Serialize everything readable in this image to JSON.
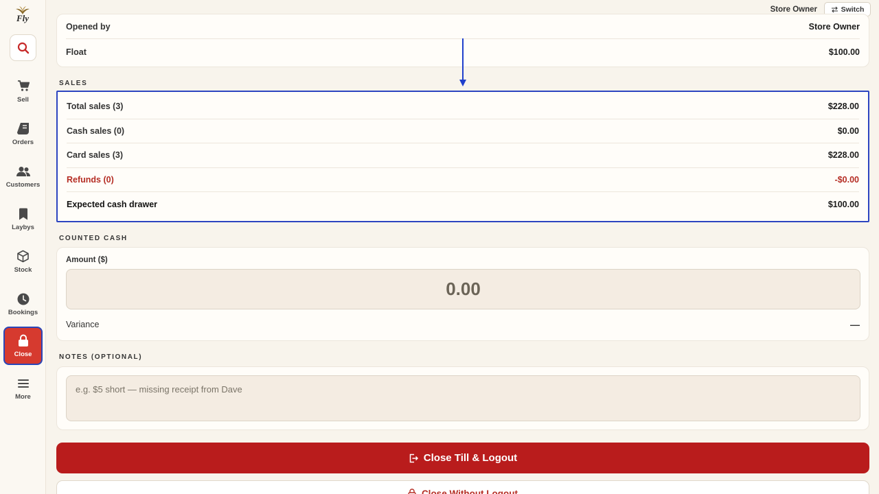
{
  "app": {
    "logo_text": "Fly"
  },
  "sidebar": {
    "items": [
      {
        "label": "Sell",
        "icon": "cart-icon"
      },
      {
        "label": "Orders",
        "icon": "receipt-icon"
      },
      {
        "label": "Customers",
        "icon": "people-icon"
      },
      {
        "label": "Laybys",
        "icon": "bookmark-icon"
      },
      {
        "label": "Stock",
        "icon": "box-icon"
      },
      {
        "label": "Bookings",
        "icon": "clock-icon"
      },
      {
        "label": "Close",
        "icon": "lock-icon",
        "active": true
      },
      {
        "label": "More",
        "icon": "menu-icon"
      }
    ]
  },
  "topbar": {
    "user": "Store Owner",
    "switch_label": "Switch"
  },
  "session": {
    "opened_by_label": "Opened by",
    "opened_by_value": "Store Owner",
    "float_label": "Float",
    "float_value": "$100.00"
  },
  "sales": {
    "title": "SALES",
    "rows": [
      {
        "label": "Total sales (3)",
        "value": "$228.00"
      },
      {
        "label": "Cash sales (0)",
        "value": "$0.00"
      },
      {
        "label": "Card sales (3)",
        "value": "$228.00"
      },
      {
        "label": "Refunds (0)",
        "value": "-$0.00"
      },
      {
        "label": "Expected cash drawer",
        "value": "$100.00"
      }
    ]
  },
  "counted_cash": {
    "title": "COUNTED CASH",
    "amount_label": "Amount ($)",
    "amount_value": "0.00",
    "variance_label": "Variance",
    "variance_value": "—"
  },
  "notes": {
    "title": "NOTES (OPTIONAL)",
    "placeholder": "e.g. $5 short — missing receipt from Dave"
  },
  "actions": {
    "primary_label": "Close Till & Logout",
    "secondary_label": "Close Without Logout"
  },
  "colors": {
    "accent_red": "#b91c1c",
    "highlight_blue": "#2c44c0",
    "background": "#f8f4ec"
  }
}
